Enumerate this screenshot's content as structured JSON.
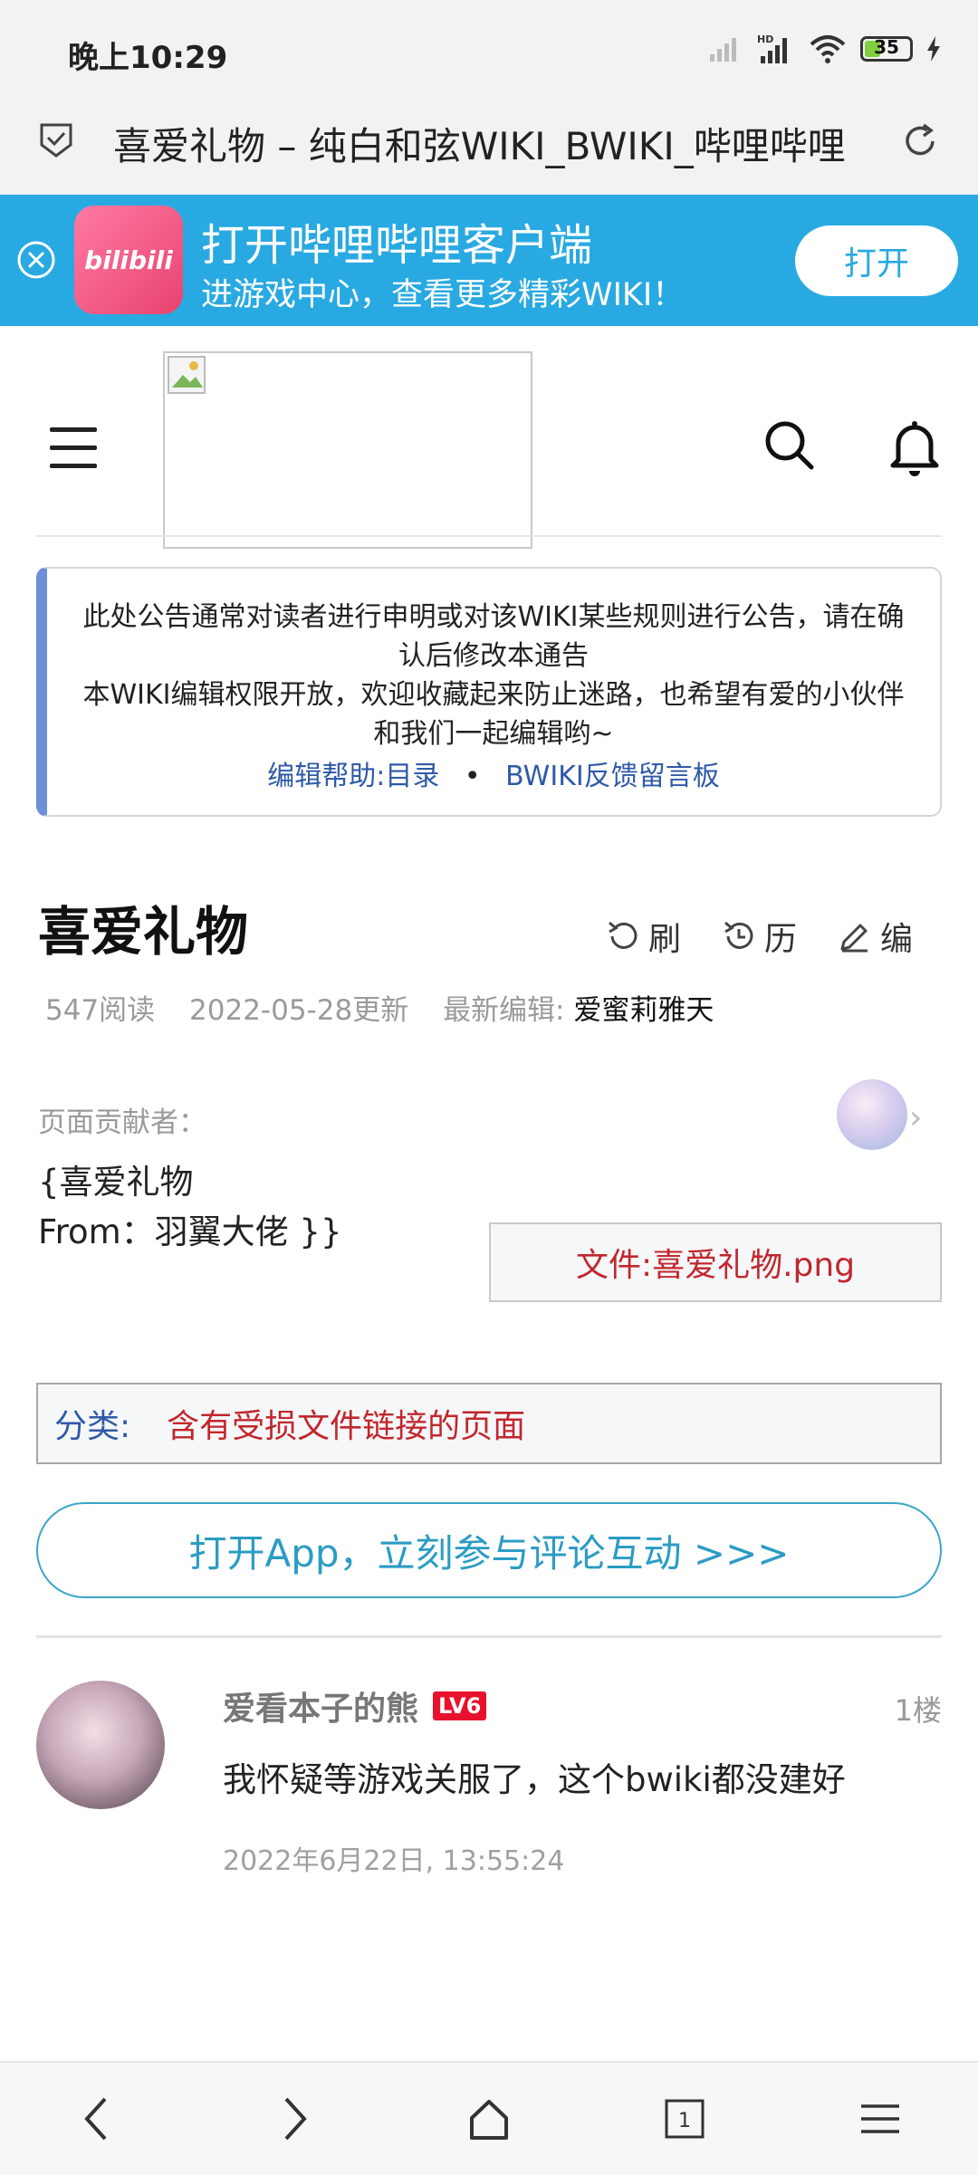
{
  "status_bar": {
    "time": "晚上10:29",
    "battery": "35",
    "battery_level": 0.35,
    "icons": [
      "signal-weak-icon",
      "hd-signal-icon",
      "wifi-icon",
      "battery-icon",
      "charging-icon"
    ]
  },
  "address_bar": {
    "title": "喜爱礼物 – 纯白和弦WIKI_BWIKI_哔哩哔哩"
  },
  "app_banner": {
    "logo_text": "bilibili",
    "title": "打开哔哩哔哩客户端",
    "subtitle": "进游戏中心，查看更多精彩WIKI！",
    "open_label": "打开",
    "color": "#29a9e1"
  },
  "notice": {
    "line1": "此处公告通常对读者进行申明或对该WIKI某些规则进行公告，请在确认后修改本通告",
    "line2": "本WIKI编辑权限开放，欢迎收藏起来防止迷路，也希望有爱的小伙伴和我们一起编辑哟~",
    "link1": "编辑帮助:目录",
    "separator": "•",
    "link2": "BWIKI反馈留言板"
  },
  "page": {
    "title": "喜爱礼物",
    "actions": {
      "refresh": "刷",
      "history": "历",
      "edit": "编"
    },
    "views": "547阅读",
    "updated": "2022-05-28更新",
    "latest_editor_label": "最新编辑:",
    "latest_editor": "爱蜜莉雅天",
    "contributors_label": "页面贡献者：",
    "template_line1": "{喜爱礼物",
    "template_line2": "From：羽翼大佬 }}",
    "file_link": "文件:喜爱礼物.png"
  },
  "category": {
    "label": "分类:",
    "value": "含有受损文件链接的页面"
  },
  "open_app_button": "打开App，立刻参与评论互动 >>>",
  "comment": {
    "username": "爱看本子的熊",
    "level": "LV6",
    "floor": "1楼",
    "text": "我怀疑等游戏关服了，这个bwiki都没建好",
    "time": "2022年6月22日, 13:55:24"
  },
  "bottom_nav": {
    "tab_count": "1"
  }
}
